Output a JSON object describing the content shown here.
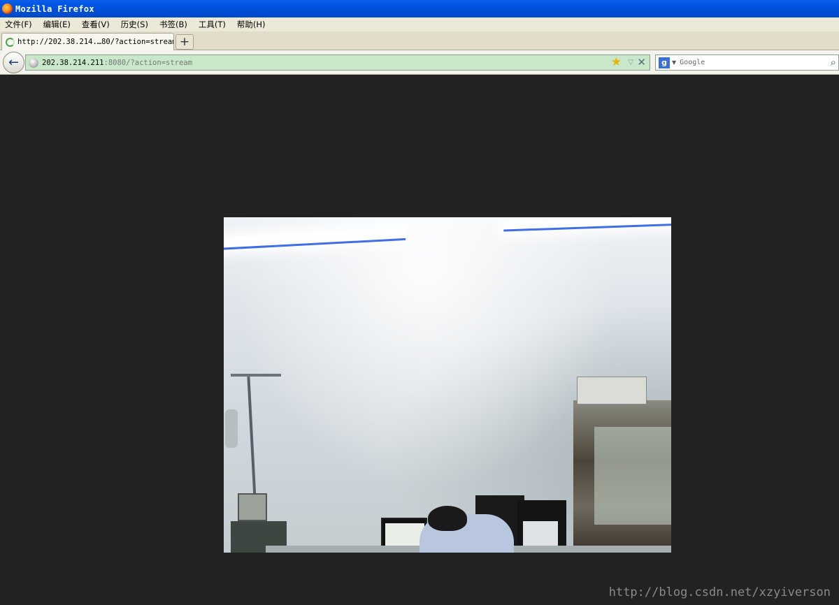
{
  "window": {
    "title": "Mozilla Firefox"
  },
  "menubar": {
    "items": [
      "文件(F)",
      "编辑(E)",
      "查看(V)",
      "历史(S)",
      "书签(B)",
      "工具(T)",
      "帮助(H)"
    ]
  },
  "tabs": [
    {
      "label": "http://202.38.214.…80/?action=stream",
      "loading": true
    }
  ],
  "new_tab_label": "+",
  "navbar": {
    "back_icon": "back-arrow-icon",
    "url_host": "202.38.214.211",
    "url_rest": ":8080/?action=stream",
    "bookmark_icon": "star-icon",
    "dropdown_icon": "history-dropdown-icon",
    "stop_icon": "stop-icon",
    "search_engine": "Google",
    "search_placeholder": "Google",
    "search_icon": "magnifier-icon"
  },
  "content": {
    "stream_description": "webcam mjpeg stream",
    "background_color": "#222222"
  },
  "watermark": "http://blog.csdn.net/xzyiverson",
  "colors": {
    "titlebar": "#0052e0",
    "urlbar_bg": "#c9e8c9",
    "menubar_bg": "#ece9d8"
  }
}
